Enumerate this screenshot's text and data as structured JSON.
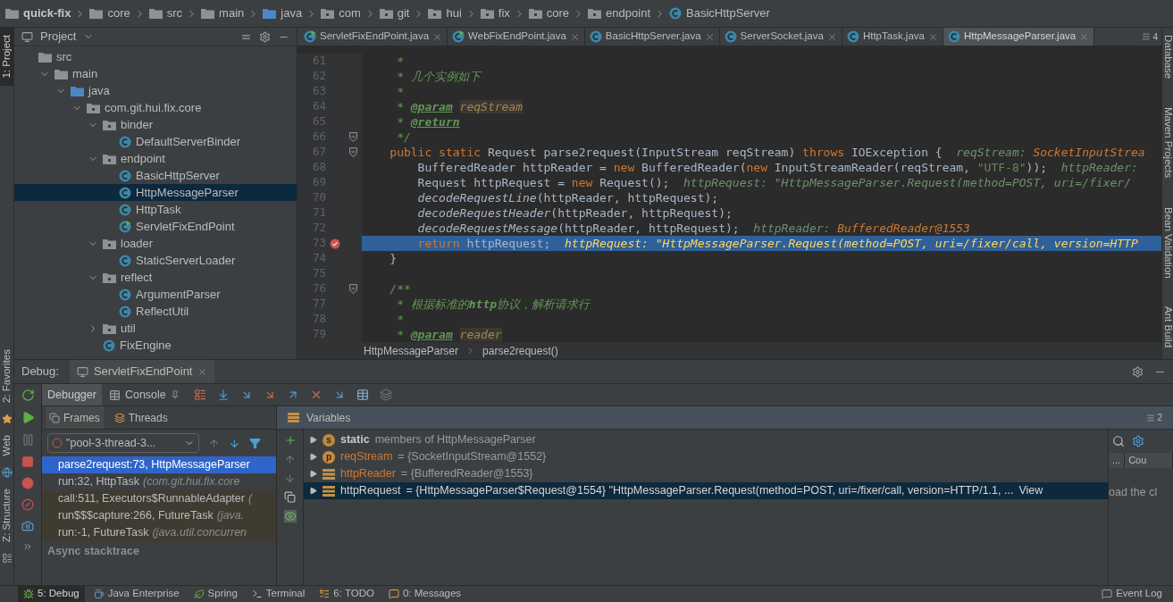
{
  "breadcrumbs": [
    {
      "kind": "project",
      "label": "quick-fix"
    },
    {
      "kind": "module",
      "label": "core"
    },
    {
      "kind": "folder",
      "label": "src"
    },
    {
      "kind": "folder",
      "label": "main"
    },
    {
      "kind": "source",
      "label": "java"
    },
    {
      "kind": "package",
      "label": "com"
    },
    {
      "kind": "package",
      "label": "git"
    },
    {
      "kind": "package",
      "label": "hui"
    },
    {
      "kind": "package",
      "label": "fix"
    },
    {
      "kind": "package",
      "label": "core"
    },
    {
      "kind": "package",
      "label": "endpoint"
    },
    {
      "kind": "class",
      "label": "BasicHttpServer"
    }
  ],
  "left_tool_windows_top": [
    {
      "label": "1: Project",
      "selected": true
    }
  ],
  "left_tool_windows_bottom": [
    {
      "label": "2: Favorites",
      "kind": "favorites",
      "selected": false
    },
    {
      "label": "Web",
      "kind": "web",
      "selected": false
    },
    {
      "label": "Z: Structure",
      "kind": "structure",
      "selected": false
    }
  ],
  "right_tool_windows": [
    {
      "label": "Database"
    },
    {
      "label": "Maven Projects"
    },
    {
      "label": "Bean Validation"
    },
    {
      "label": "Ant Build"
    }
  ],
  "project_panel": {
    "title": "Project",
    "tree": [
      {
        "label": "src",
        "kind": "folder",
        "selected": false,
        "children": [
          {
            "label": "main",
            "kind": "folder",
            "expanded": true,
            "selected": false,
            "children": [
              {
                "label": "java",
                "kind": "source",
                "expanded": true,
                "selected": false,
                "children": [
                  {
                    "label": "com.git.hui.fix.core",
                    "kind": "package",
                    "expanded": true,
                    "selected": false,
                    "children": [
                      {
                        "label": "binder",
                        "kind": "package",
                        "expanded": true,
                        "selected": false,
                        "children": [
                          {
                            "label": "DefaultServerBinder",
                            "kind": "class",
                            "selected": false
                          }
                        ]
                      },
                      {
                        "label": "endpoint",
                        "kind": "package",
                        "expanded": true,
                        "selected": false,
                        "children": [
                          {
                            "label": "BasicHttpServer",
                            "kind": "class",
                            "selected": false
                          },
                          {
                            "label": "HttpMessageParser",
                            "kind": "class",
                            "selected": true
                          },
                          {
                            "label": "HttpTask",
                            "kind": "class",
                            "selected": false
                          },
                          {
                            "label": "ServletFixEndPoint",
                            "kind": "runnable_class",
                            "selected": false
                          }
                        ]
                      },
                      {
                        "label": "loader",
                        "kind": "package",
                        "expanded": true,
                        "selected": false,
                        "children": [
                          {
                            "label": "StaticServerLoader",
                            "kind": "class",
                            "selected": false
                          }
                        ]
                      },
                      {
                        "label": "reflect",
                        "kind": "package",
                        "expanded": true,
                        "selected": false,
                        "children": [
                          {
                            "label": "ArgumentParser",
                            "kind": "class",
                            "selected": false
                          },
                          {
                            "label": "ReflectUtil",
                            "kind": "class",
                            "selected": false
                          }
                        ]
                      },
                      {
                        "label": "util",
                        "kind": "package",
                        "expanded": false,
                        "selected": false
                      },
                      {
                        "label": "FixEngine",
                        "kind": "class",
                        "selected": false
                      }
                    ]
                  }
                ]
              }
            ]
          }
        ]
      }
    ]
  },
  "editor": {
    "tabs": [
      {
        "label": "ServletFixEndPoint.java",
        "kind": "runnable_class",
        "selected": false
      },
      {
        "label": "WebFixEndPoint.java",
        "kind": "runnable_class",
        "selected": false
      },
      {
        "label": "BasicHttpServer.java",
        "kind": "class",
        "selected": false
      },
      {
        "label": "ServerSocket.java",
        "kind": "class",
        "selected": false
      },
      {
        "label": "HttpTask.java",
        "kind": "class",
        "selected": false
      },
      {
        "label": "HttpMessageParser.java",
        "kind": "class",
        "selected": true
      }
    ],
    "tabs_overflow_count": "4",
    "lines": [
      {
        "number": "61",
        "fold": false,
        "breakpoint": false,
        "current": false,
        "segments": [
          {
            "kind": "doc",
            "text": "     *"
          }
        ]
      },
      {
        "number": "62",
        "fold": false,
        "breakpoint": false,
        "current": false,
        "segments": [
          {
            "kind": "doc",
            "text": "     * 几个实例如下"
          }
        ]
      },
      {
        "number": "63",
        "fold": false,
        "breakpoint": false,
        "current": false,
        "segments": [
          {
            "kind": "doc",
            "text": "     *"
          }
        ]
      },
      {
        "number": "64",
        "fold": false,
        "breakpoint": false,
        "current": false,
        "segments": [
          {
            "kind": "doc",
            "text": "     * "
          },
          {
            "kind": "doctag",
            "text": "@param"
          },
          {
            "kind": "docref",
            "text": "reqStream"
          }
        ]
      },
      {
        "number": "65",
        "fold": false,
        "breakpoint": false,
        "current": false,
        "segments": [
          {
            "kind": "doc",
            "text": "     * "
          },
          {
            "kind": "doctag",
            "text": "@return"
          }
        ]
      },
      {
        "number": "66",
        "fold": true,
        "breakpoint": false,
        "current": false,
        "segments": [
          {
            "kind": "doc",
            "text": "     */"
          }
        ]
      },
      {
        "number": "67",
        "fold": true,
        "breakpoint": false,
        "current": false,
        "segments": [
          {
            "kind": "keyword",
            "text": "    public static "
          },
          {
            "kind": "plain",
            "text": "Request parse2request(InputStream reqStream) "
          },
          {
            "kind": "keyword",
            "text": "throws "
          },
          {
            "kind": "plain",
            "text": "IOException {  "
          },
          {
            "kind": "hint_name",
            "text": "reqStream: "
          },
          {
            "kind": "hint_value",
            "text": "SocketInputStrea"
          }
        ]
      },
      {
        "number": "68",
        "fold": false,
        "breakpoint": false,
        "current": false,
        "segments": [
          {
            "kind": "plain",
            "text": "        BufferedReader httpReader = "
          },
          {
            "kind": "keyword",
            "text": "new "
          },
          {
            "kind": "plain",
            "text": "BufferedReader("
          },
          {
            "kind": "keyword",
            "text": "new "
          },
          {
            "kind": "plain",
            "text": "InputStreamReader(reqStream, "
          },
          {
            "kind": "string",
            "text": "\"UTF-8\""
          },
          {
            "kind": "plain",
            "text": "));  "
          },
          {
            "kind": "hint_name",
            "text": "httpReader:"
          }
        ]
      },
      {
        "number": "69",
        "fold": false,
        "breakpoint": false,
        "current": false,
        "segments": [
          {
            "kind": "plain",
            "text": "        Request httpRequest = "
          },
          {
            "kind": "keyword",
            "text": "new "
          },
          {
            "kind": "plain",
            "text": "Request();  "
          },
          {
            "kind": "hint_name",
            "text": "httpRequest: "
          },
          {
            "kind": "hint_name",
            "text": "\"HttpMessageParser.Request(method=POST, uri=/fixer/"
          }
        ]
      },
      {
        "number": "70",
        "fold": false,
        "breakpoint": false,
        "current": false,
        "segments": [
          {
            "kind": "method",
            "text": "        decodeRequestLine"
          },
          {
            "kind": "plain",
            "text": "(httpReader, httpRequest);"
          }
        ]
      },
      {
        "number": "71",
        "fold": false,
        "breakpoint": false,
        "current": false,
        "segments": [
          {
            "kind": "method",
            "text": "        decodeRequestHeader"
          },
          {
            "kind": "plain",
            "text": "(httpReader, httpRequest);"
          }
        ]
      },
      {
        "number": "72",
        "fold": false,
        "breakpoint": false,
        "current": false,
        "segments": [
          {
            "kind": "method",
            "text": "        decodeRequestMessage"
          },
          {
            "kind": "plain",
            "text": "(httpReader, httpRequest);  "
          },
          {
            "kind": "hint_name",
            "text": "httpReader: "
          },
          {
            "kind": "hint_value",
            "text": "BufferedReader@1553"
          }
        ]
      },
      {
        "number": "73",
        "fold": false,
        "breakpoint": true,
        "current": true,
        "segments": [
          {
            "kind": "keyword",
            "text": "        return "
          },
          {
            "kind": "plain",
            "text": "httpRequest;  "
          },
          {
            "kind": "current_hint",
            "text": "httpRequest: \"HttpMessageParser.Request(method=POST, uri=/fixer/call, version=HTTP"
          }
        ]
      },
      {
        "number": "74",
        "fold": false,
        "breakpoint": false,
        "current": false,
        "segments": [
          {
            "kind": "plain",
            "text": "    }"
          }
        ]
      },
      {
        "number": "75",
        "fold": false,
        "breakpoint": false,
        "current": false
      },
      {
        "number": "76",
        "fold": true,
        "breakpoint": false,
        "current": false,
        "segments": [
          {
            "kind": "doc",
            "text": "    /**"
          }
        ]
      },
      {
        "number": "77",
        "fold": false,
        "breakpoint": false,
        "current": false,
        "segments": [
          {
            "kind": "doc",
            "text": "     * 根据标准的"
          },
          {
            "kind": "doc_bold",
            "text": "http"
          },
          {
            "kind": "doc",
            "text": "协议，解析请求行"
          }
        ]
      },
      {
        "number": "78",
        "fold": false,
        "breakpoint": false,
        "current": false,
        "segments": [
          {
            "kind": "doc",
            "text": "     *"
          }
        ]
      },
      {
        "number": "79",
        "fold": false,
        "breakpoint": false,
        "current": false,
        "segments": [
          {
            "kind": "doc",
            "text": "     * "
          },
          {
            "kind": "doctag",
            "text": "@param"
          },
          {
            "kind": "docref",
            "text": "reader"
          }
        ]
      }
    ],
    "breadcrumb": [
      "HttpMessageParser",
      "parse2request()"
    ]
  },
  "debug": {
    "label": "Debug:",
    "session": "ServletFixEndPoint",
    "tabs": [
      {
        "label": "Debugger",
        "selected": true
      },
      {
        "label": "Console",
        "selected": false
      }
    ],
    "frames_header": [
      "Frames",
      "Threads"
    ],
    "thread": "\"pool-3-thread-3...",
    "frames": [
      {
        "method": "parse2request:73, HttpMessageParser",
        "selected": true,
        "library": false
      },
      {
        "method": "run:32, HttpTask",
        "detail": "(com.git.hui.fix.core",
        "selected": false,
        "library": false
      },
      {
        "method": "call:511, Executors$RunnableAdapter",
        "detail": "(",
        "selected": false,
        "library": true
      },
      {
        "method": "run$$$capture:266, FutureTask",
        "detail": "(java.",
        "selected": false,
        "library": true
      },
      {
        "method": "run:-1, FutureTask",
        "detail": "(java.util.concurren",
        "selected": false,
        "library": true
      }
    ],
    "async_label": "Async stacktrace",
    "variables_title": "Variables",
    "layout_count": "2",
    "variables": [
      {
        "kind": "static",
        "name": "static",
        "value": "members of HttpMessageParser",
        "selected": false
      },
      {
        "kind": "parameter",
        "badge": "p",
        "name": "reqStream",
        "value": "= {SocketInputStream@1552}",
        "selected": false
      },
      {
        "kind": "field",
        "name": "httpReader",
        "value": "= {BufferedReader@1553}",
        "selected": false
      },
      {
        "kind": "field",
        "name": "httpRequest",
        "value": "= {HttpMessageParser$Request@1554} \"HttpMessageParser.Request(method=POST, uri=/fixer/call, version=HTTP/1.1, ...",
        "link": "View",
        "selected": true
      }
    ],
    "static_badge": "s",
    "side_pane": {
      "columns": [
        "...",
        "Cou"
      ],
      "text": "oad the cl"
    }
  },
  "status_bar": {
    "items": [
      {
        "label": "5: Debug",
        "kind": "debug",
        "selected": true
      },
      {
        "label": "Java Enterprise",
        "kind": "enterprise",
        "selected": false
      },
      {
        "label": "Spring",
        "kind": "spring",
        "selected": false
      },
      {
        "label": "Terminal",
        "kind": "terminal",
        "selected": false
      },
      {
        "label": "6: TODO",
        "kind": "todo",
        "selected": false
      },
      {
        "label": "0: Messages",
        "kind": "messages",
        "selected": false
      }
    ],
    "event_log": "Event Log"
  }
}
